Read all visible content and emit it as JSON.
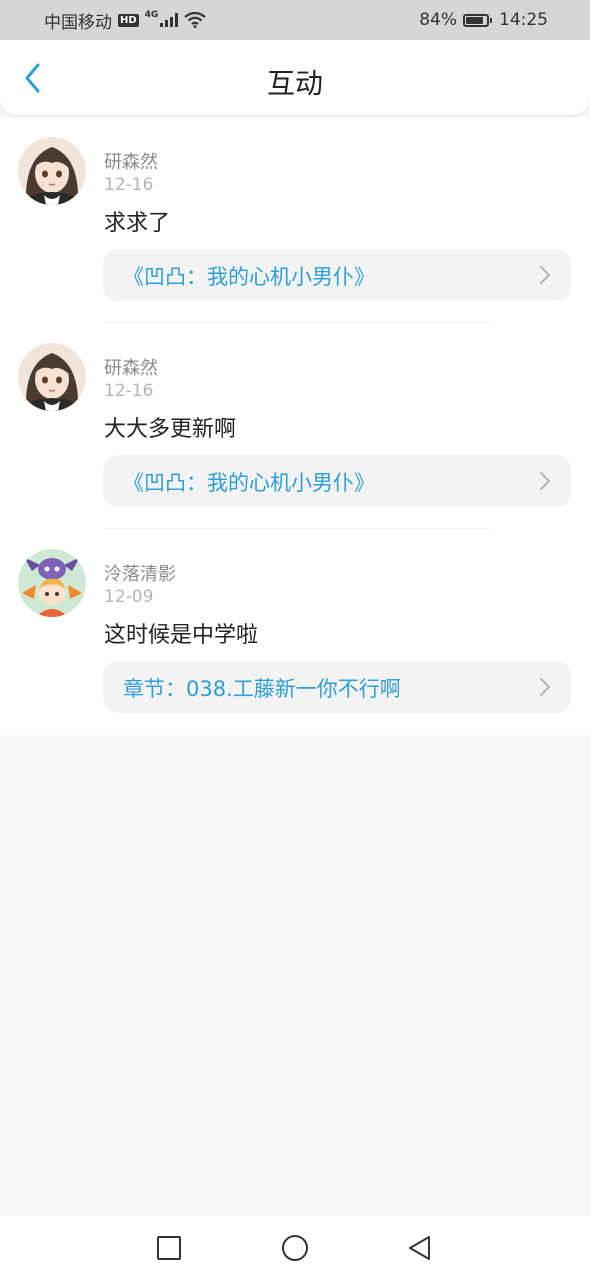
{
  "status_bar": {
    "carrier": "中国移动",
    "hd_badge": "HD",
    "network_type": "4G",
    "battery_percent": "84%",
    "battery_level": 0.84,
    "time": "14:25"
  },
  "header": {
    "title": "互动",
    "back_icon": "chevron-left-icon",
    "accent_color": "#2f9ed8"
  },
  "comments": [
    {
      "username": "研森然",
      "date": "12-16",
      "text": "求求了",
      "reference": "《凹凸：我的心机小男仆》"
    },
    {
      "username": "研森然",
      "date": "12-16",
      "text": "大大多更新啊",
      "reference": "《凹凸：我的心机小男仆》"
    },
    {
      "username": "泠落清影",
      "date": "12-09",
      "text": "这时候是中学啦",
      "reference": "章节：038.工藤新一你不行啊"
    }
  ],
  "nav_bar": {
    "recents_icon": "square-icon",
    "home_icon": "circle-icon",
    "back_icon": "triangle-back-icon"
  }
}
